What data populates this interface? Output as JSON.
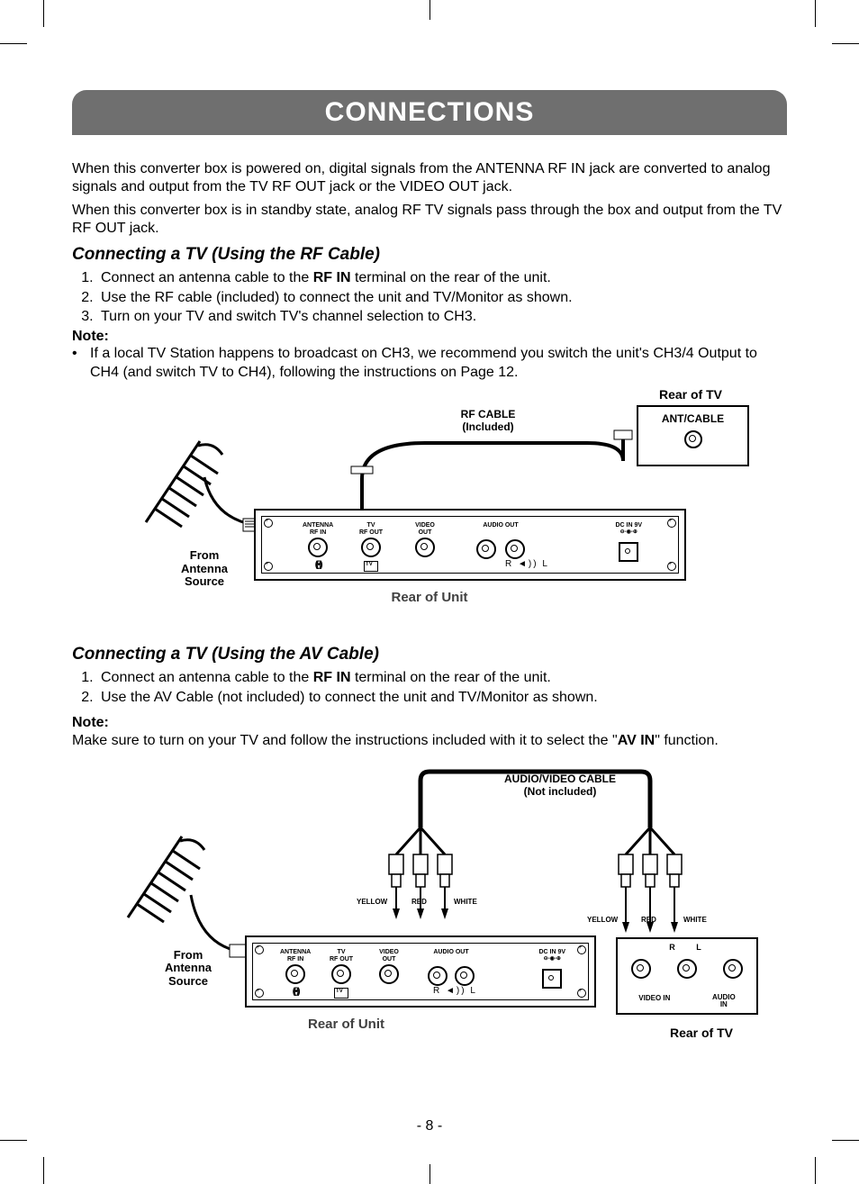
{
  "title": "CONNECTIONS",
  "intro1": "When this converter box is powered on, digital signals from the ANTENNA RF IN jack are converted to analog signals and output from the TV RF OUT jack or the VIDEO OUT jack.",
  "intro2": "When this converter box is in standby state, analog RF TV signals pass through the box and output from the TV RF OUT jack.",
  "sectionA": {
    "heading": "Connecting a TV (Using the RF Cable)",
    "step1a": "Connect an antenna cable to the ",
    "step1b": "RF IN",
    "step1c": " terminal on the rear of the unit.",
    "step2": "Use the RF cable (included) to connect the unit and TV/Monitor as shown.",
    "step3": "Turn on your TV and switch TV's channel selection to CH3.",
    "noteHead": "Note:",
    "noteBullet": "•",
    "note": "If a local TV Station happens to broadcast on CH3, we recommend you switch the unit's CH3/4 Output to CH4 (and switch TV to CH4), following the instructions on Page 12."
  },
  "diagramRF": {
    "rearTV": "Rear of TV",
    "antCable": "ANT/CABLE",
    "rfCable1": "RF CABLE",
    "rfCable2": "(Included)",
    "fromAntenna1": "From",
    "fromAntenna2": "Antenna",
    "fromAntenna3": "Source",
    "rearUnit": "Rear of Unit",
    "portAntenna1": "ANTENNA",
    "portAntenna2": "RF IN",
    "portTV1": "TV",
    "portTV2": "RF OUT",
    "portVideo1": "VIDEO",
    "portVideo2": "OUT",
    "portAudio": "AUDIO OUT",
    "portDC1": "DC IN 9V",
    "portRL": "R     L"
  },
  "sectionB": {
    "heading": "Connecting a TV (Using the AV Cable)",
    "step1a": "Connect an antenna cable to the ",
    "step1b": "RF IN",
    "step1c": " terminal on the rear of the unit.",
    "step2": "Use the AV Cable (not included) to connect the unit and TV/Monitor as shown.",
    "noteHead": "Note:",
    "noteBodyA": "Make sure to turn on your TV and follow the instructions included with it to select the \"",
    "noteBodyB": "AV IN",
    "noteBodyC": "\" function."
  },
  "diagramAV": {
    "cable1": "AUDIO/VIDEO CABLE",
    "cable2": "(Not included)",
    "yellow": "YELLOW",
    "red": "RED",
    "white": "WHITE",
    "rearUnit": "Rear of Unit",
    "rearTV": "Rear of TV",
    "tvR": "R",
    "tvL": "L",
    "videoIn": "VIDEO IN",
    "audioIn1": "AUDIO",
    "audioIn2": "IN"
  },
  "pageNumber": "- 8 -"
}
